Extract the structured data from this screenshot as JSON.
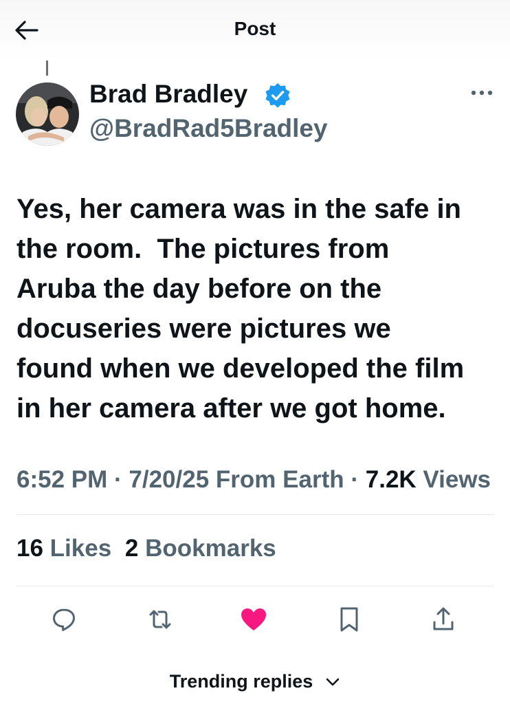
{
  "header": {
    "title": "Post"
  },
  "author": {
    "display_name": "Brad Bradley",
    "handle": "@BradRad5Bradley",
    "verified": true
  },
  "post": {
    "text": "Yes, her camera was in the safe in\nthe room.  The pictures from\nAruba the day before on the\ndocuseries were pictures we\nfound when we developed the film\nin her camera after we got home."
  },
  "meta": {
    "time": "6:52 PM",
    "date": "7/20/25",
    "source": "From Earth",
    "separator": "·",
    "views_count": "7.2K",
    "views_label": "Views"
  },
  "stats": {
    "likes_count": "16",
    "likes_label": "Likes",
    "bookmarks_count": "2",
    "bookmarks_label": "Bookmarks"
  },
  "actions": [
    "reply",
    "repost",
    "like",
    "bookmark",
    "share"
  ],
  "colors": {
    "text": "#0f1419",
    "secondary": "#536471",
    "like": "#f91880",
    "verified": "#1d9bf0",
    "icon": "#536471"
  },
  "footer": {
    "trending_label": "Trending replies"
  }
}
